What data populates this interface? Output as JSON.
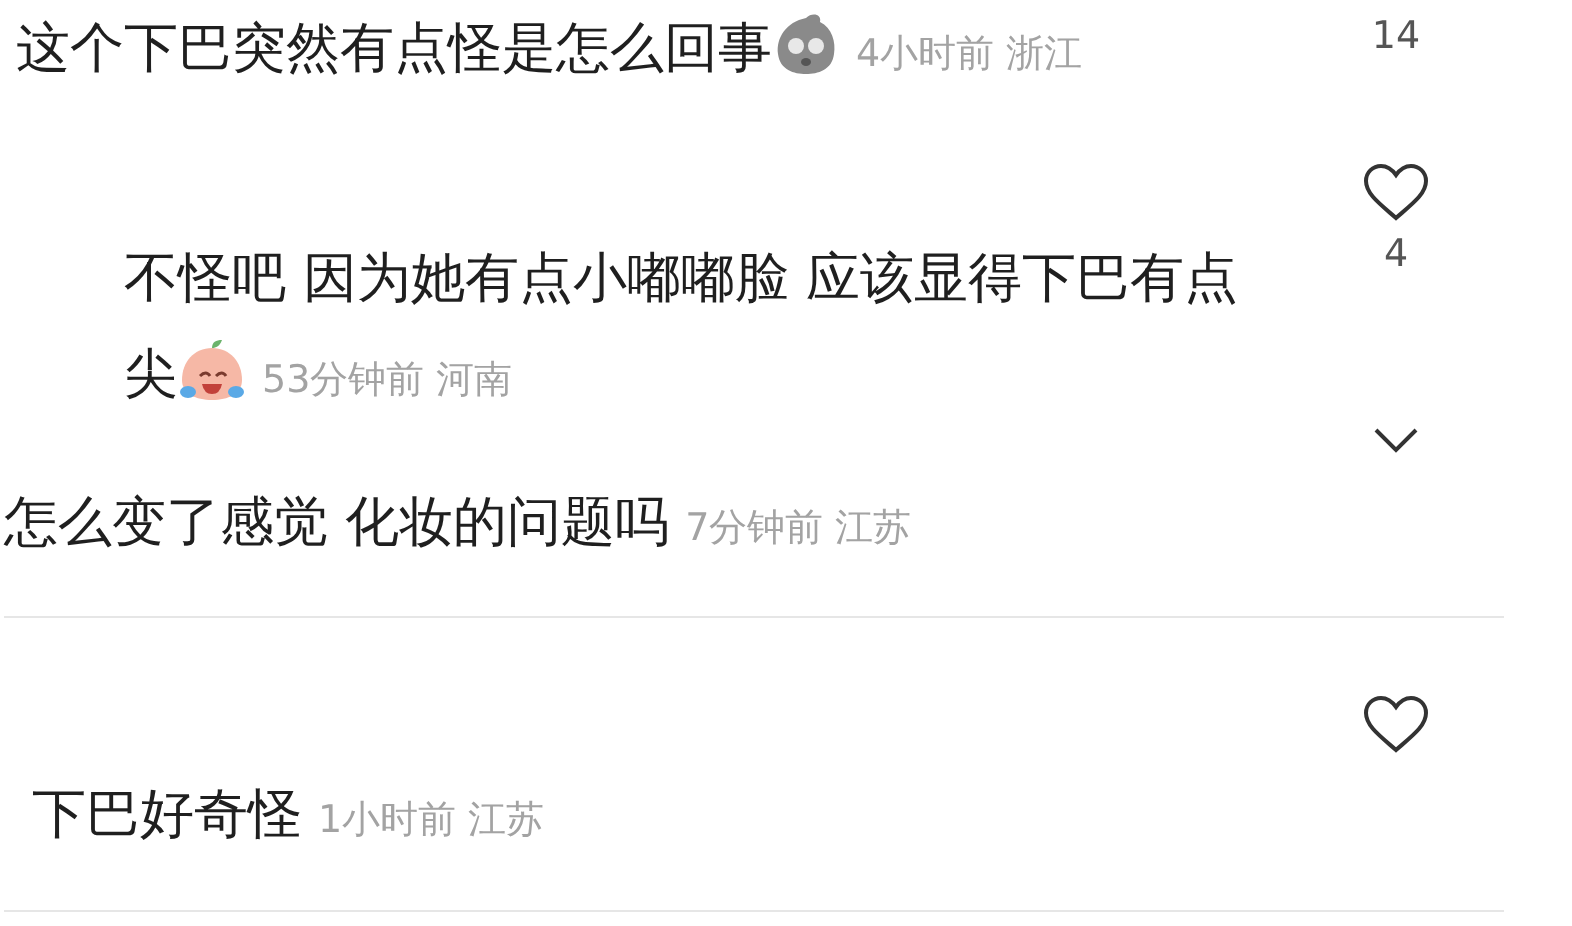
{
  "comments": [
    {
      "text": "这个下巴突然有点怪是怎么回事",
      "emoji": {
        "kind": "worried"
      },
      "time": "4小时前",
      "region": "浙江",
      "likes": "14"
    },
    {
      "text": "不怪吧 因为她有点小嘟嘟脸 应该显得下巴有点尖",
      "emoji": {
        "kind": "laughing"
      },
      "time": "53分钟前",
      "region": "河南",
      "likes": "4"
    },
    {
      "text": "怎么变了感觉 化妆的问题吗",
      "time": "7分钟前",
      "region": "江苏"
    },
    {
      "text": "下巴好奇怪",
      "time": "1小时前",
      "region": "江苏"
    }
  ]
}
